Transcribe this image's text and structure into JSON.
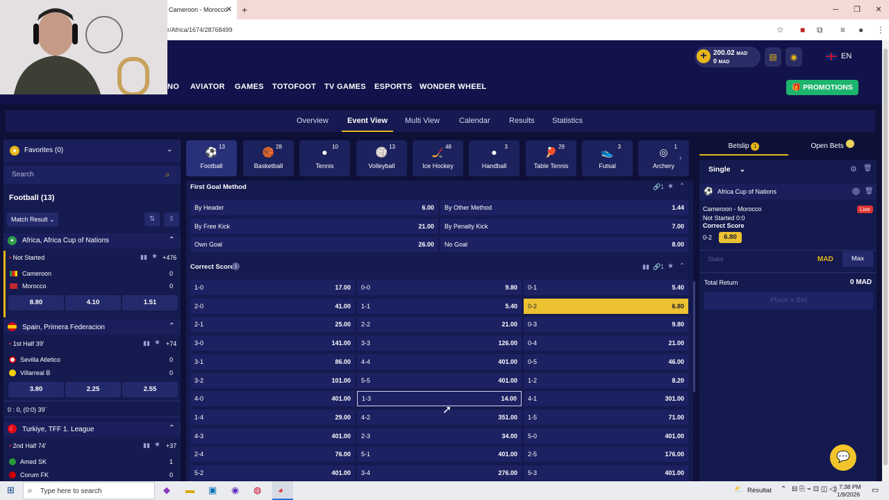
{
  "browser": {
    "tab_title": "Cameroon - Morocco",
    "url": "r/Africa/1674/28768499"
  },
  "header": {
    "balance": "200.02",
    "balance_currency": "MAD",
    "bonus": "0",
    "bonus_currency": "MAD",
    "language": "EN"
  },
  "nav": {
    "items": [
      "NO",
      "AVIATOR",
      "GAMES",
      "TOTOFOOT",
      "TV GAMES",
      "ESPORTS",
      "WONDER WHEEL"
    ],
    "promotions": "PROMOTIONS"
  },
  "subnav": {
    "items": [
      "Overview",
      "Event View",
      "Multi View",
      "Calendar",
      "Results",
      "Statistics"
    ],
    "active": "Event View"
  },
  "left": {
    "favorites": "Favorites (0)",
    "search_placeholder": "Search",
    "sport_title": "Football (13)",
    "market_filter": "Match Result",
    "leagues": [
      {
        "name": "Africa, Africa Cup of Nations",
        "status": "Not Started",
        "more": "+476",
        "team1": "Cameroon",
        "score1": "0",
        "team2": "Morocco",
        "score2": "0",
        "odds": [
          "8.80",
          "4.10",
          "1.51"
        ]
      },
      {
        "name": "Spain, Primera Federacion",
        "status": "1st Half 39'",
        "more": "+74",
        "team1": "Sevilla Atletico",
        "score1": "0",
        "team2": "Villarreal B",
        "score2": "0",
        "odds": [
          "3.80",
          "2.25",
          "2.55"
        ],
        "extra": "0 : 0, (0:0) 39`"
      },
      {
        "name": "Turkiye, TFF 1. League",
        "status": "2nd Half 74'",
        "more": "+37",
        "team1": "Amed SK",
        "score1": "1",
        "team2": "Corum FK",
        "score2": "0"
      }
    ]
  },
  "sports": [
    {
      "name": "Football",
      "count": "13",
      "icon": "⚽"
    },
    {
      "name": "Basketball",
      "count": "28",
      "icon": "🏀"
    },
    {
      "name": "Tennis",
      "count": "10",
      "icon": "●"
    },
    {
      "name": "Volleyball",
      "count": "13",
      "icon": "🏐"
    },
    {
      "name": "Ice Hockey",
      "count": "48",
      "icon": "🏒"
    },
    {
      "name": "Handball",
      "count": "3",
      "icon": "●"
    },
    {
      "name": "Table Tennis",
      "count": "29",
      "icon": "🏓"
    },
    {
      "name": "Futsal",
      "count": "3",
      "icon": "👟"
    },
    {
      "name": "Archery",
      "count": "1",
      "icon": "◎"
    }
  ],
  "first_goal": {
    "title": "First Goal Method",
    "count": "1",
    "cells": [
      [
        "By Header",
        "6.00"
      ],
      [
        "By Other Method",
        "1.44"
      ],
      [
        "By Free Kick",
        "21.00"
      ],
      [
        "By Penalty Kick",
        "7.00"
      ],
      [
        "Own Goal",
        "26.00"
      ],
      [
        "No Goal",
        "8.00"
      ]
    ]
  },
  "correct_score": {
    "title": "Correct Score",
    "count": "1",
    "rows": [
      [
        [
          "1-0",
          "17.00"
        ],
        [
          "0-0",
          "9.80"
        ],
        [
          "0-1",
          "5.40"
        ]
      ],
      [
        [
          "2-0",
          "41.00"
        ],
        [
          "1-1",
          "5.40"
        ],
        [
          "0-2",
          "6.80"
        ]
      ],
      [
        [
          "2-1",
          "25.00"
        ],
        [
          "2-2",
          "21.00"
        ],
        [
          "0-3",
          "9.80"
        ]
      ],
      [
        [
          "3-0",
          "141.00"
        ],
        [
          "3-3",
          "126.00"
        ],
        [
          "0-4",
          "21.00"
        ]
      ],
      [
        [
          "3-1",
          "86.00"
        ],
        [
          "4-4",
          "401.00"
        ],
        [
          "0-5",
          "46.00"
        ]
      ],
      [
        [
          "3-2",
          "101.00"
        ],
        [
          "5-5",
          "401.00"
        ],
        [
          "1-2",
          "8.20"
        ]
      ],
      [
        [
          "4-0",
          "401.00"
        ],
        [
          "1-3",
          "14.00"
        ],
        [
          "4-1",
          "301.00"
        ]
      ],
      [
        [
          "1-4",
          "29.00"
        ],
        [
          "4-2",
          "351.00"
        ],
        [
          "1-5",
          "71.00"
        ]
      ],
      [
        [
          "4-3",
          "401.00"
        ],
        [
          "2-3",
          "34.00"
        ],
        [
          "5-0",
          "401.00"
        ]
      ],
      [
        [
          "2-4",
          "76.00"
        ],
        [
          "5-1",
          "401.00"
        ],
        [
          "2-5",
          "176.00"
        ]
      ],
      [
        [
          "5-2",
          "401.00"
        ],
        [
          "3-4",
          "276.00"
        ],
        [
          "5-3",
          "401.00"
        ]
      ]
    ]
  },
  "betslip": {
    "tab1": "Betslip",
    "tab1_badge": "1",
    "tab2": "Open Bets",
    "type": "Single",
    "league": "Africa Cup of Nations",
    "match": "Cameroon - Morocco",
    "live": "Live",
    "state": "Not Started 0:0",
    "market": "Correct Score",
    "pick": "0-2",
    "odd": "6.80",
    "stake_placeholder": "Stake",
    "currency": "MAD",
    "max": "Max",
    "total_label": "Total Return",
    "total_value": "0 MAD",
    "place": "Place a Bet"
  },
  "taskbar": {
    "search": "Type here to search",
    "weather": "Résultat",
    "time": "7:38 PM",
    "date": "1/9/2026"
  }
}
